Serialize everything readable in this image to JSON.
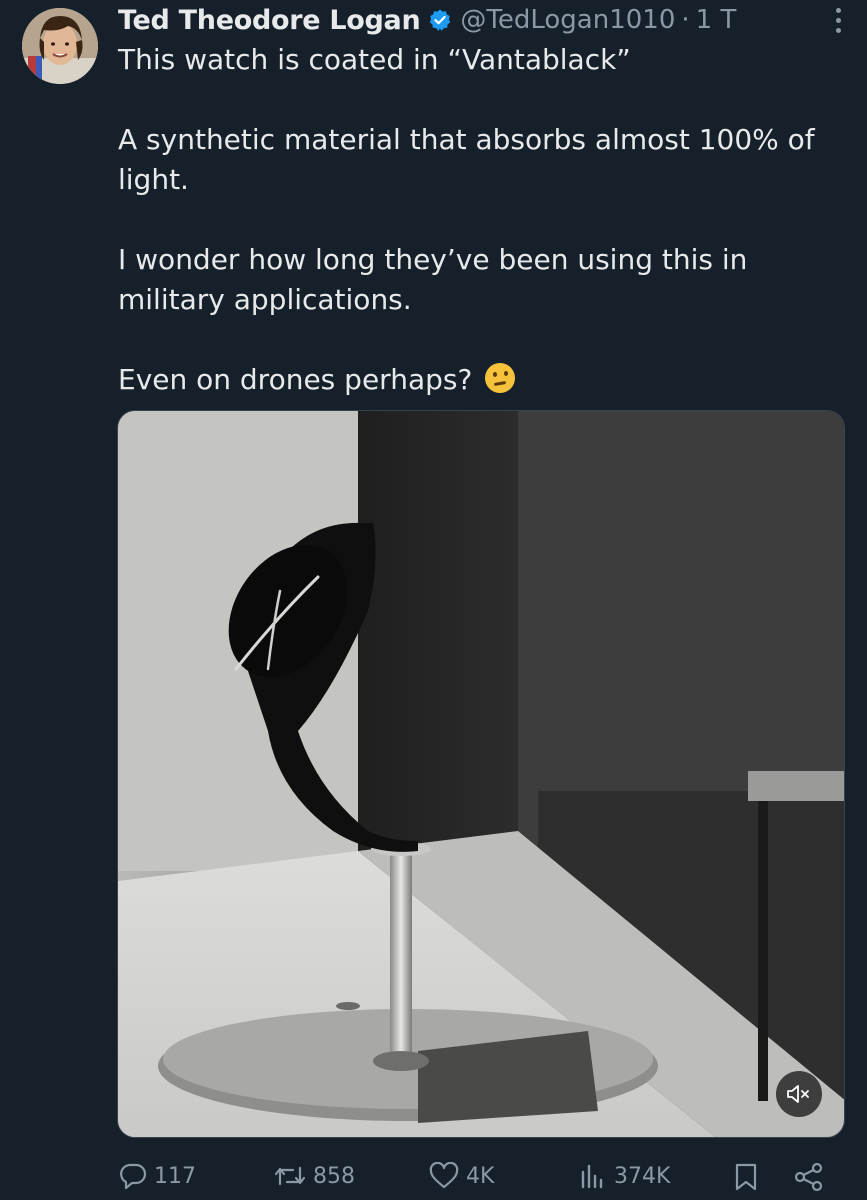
{
  "tweet": {
    "author_name": "Ted Theodore Logan",
    "author_handle": "@TedLogan1010",
    "separator": "·",
    "time": "1 T",
    "text": {
      "line1": "This watch is coated in “Vantablack”",
      "line2": "A synthetic material that absorbs almost 100% of light.",
      "line3": "I wonder how long they’ve been using this in military applications.",
      "line4": "Even on drones perhaps?"
    },
    "emoji": "thinking-face"
  },
  "media": {
    "type": "video",
    "muted": true
  },
  "actions": {
    "replies": "117",
    "reposts": "858",
    "likes": "4K",
    "views": "374K"
  },
  "colors": {
    "background": "#15202b",
    "text": "#e7e9ea",
    "secondary": "#8b98a5",
    "verified": "#1d9bf0"
  }
}
